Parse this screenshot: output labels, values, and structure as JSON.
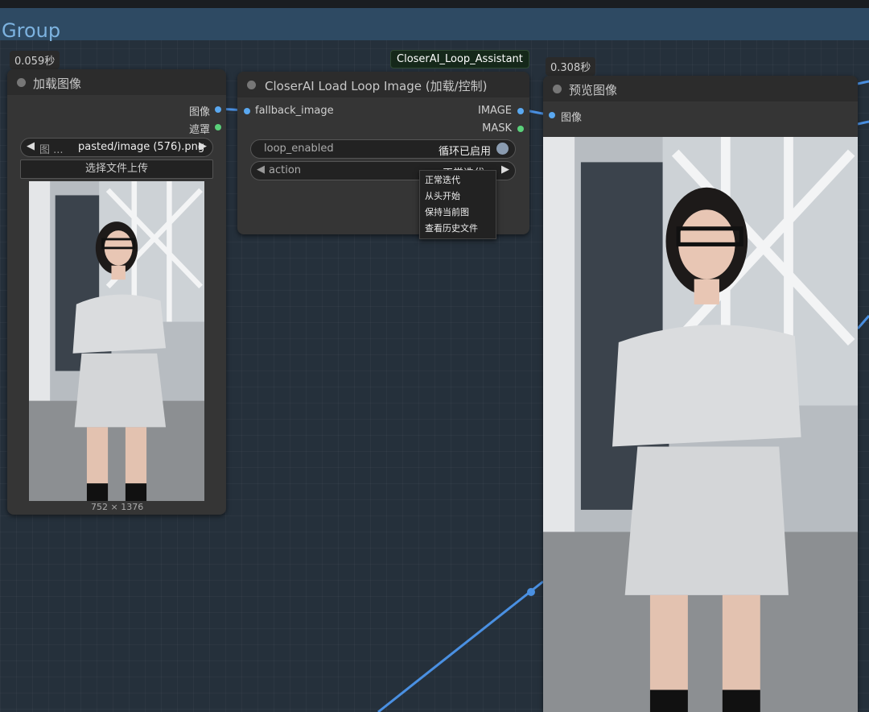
{
  "group": {
    "title": "Group"
  },
  "node_tag": "CloserAI_Loop_Assistant",
  "load_node": {
    "time": "0.059秒",
    "title": "加载图像",
    "outputs": [
      "图像",
      "遮罩"
    ],
    "image_widget": {
      "prefix": "图 ...",
      "value": "pasted/image (576).png"
    },
    "upload_button": "选择文件上传",
    "dimensions": "752 × 1376"
  },
  "loop_node": {
    "title": "CloserAI Load Loop Image (加载/控制)",
    "input": "fallback_image",
    "outputs": [
      "IMAGE",
      "MASK"
    ],
    "toggle": {
      "label": "loop_enabled",
      "value": "循环已启用"
    },
    "combo": {
      "label": "action",
      "value": "正常迭代"
    }
  },
  "context_menu": {
    "items": [
      "正常迭代",
      "从头开始",
      "保持当前图",
      "查看历史文件"
    ]
  },
  "preview_node": {
    "time": "0.308秒",
    "title": "预览图像",
    "input": "图像"
  },
  "colors": {
    "image_slot": "#5aa8f0",
    "mask_slot": "#5ad07a",
    "wire": "#4a90e2",
    "group_title": "#7db3e0"
  },
  "icons": [
    "arrow-left-icon",
    "arrow-right-icon",
    "status-dot-icon"
  ]
}
